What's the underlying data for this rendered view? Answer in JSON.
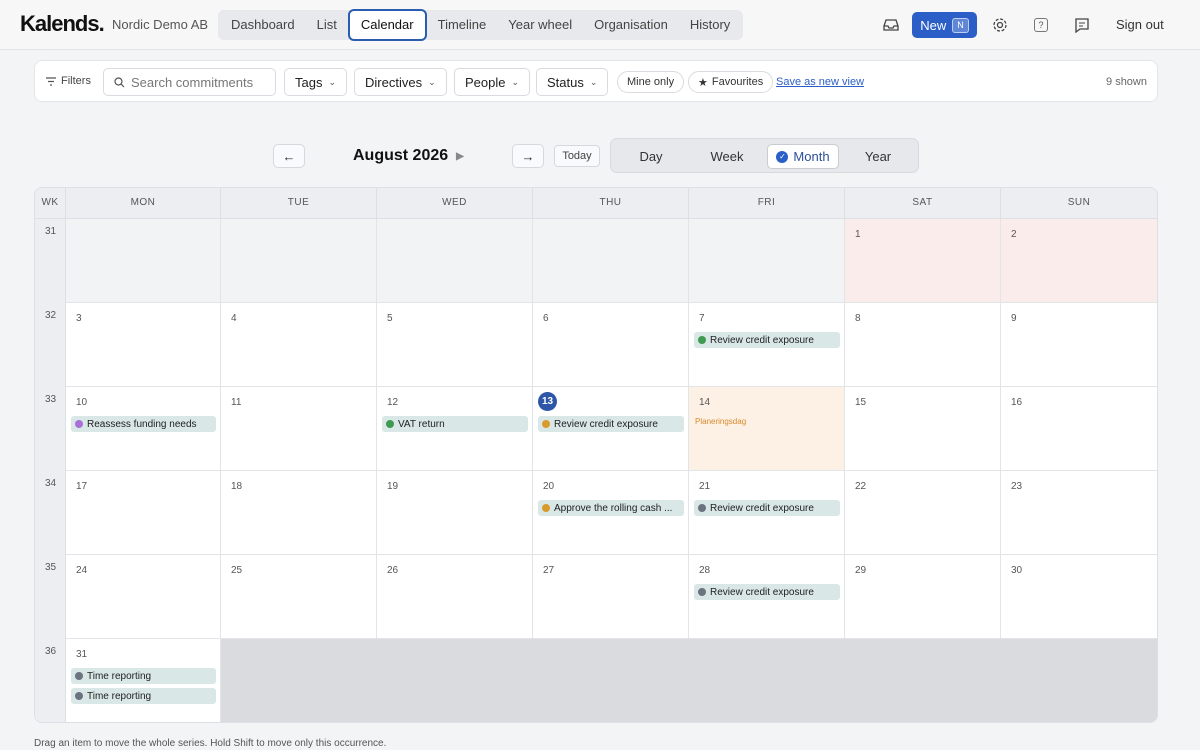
{
  "app": {
    "logo": "Kalends.",
    "org": "Nordic Demo AB"
  },
  "nav": {
    "tabs": [
      {
        "label": "Dashboard"
      },
      {
        "label": "List"
      },
      {
        "label": "Calendar",
        "active": true
      },
      {
        "label": "Timeline"
      },
      {
        "label": "Year wheel"
      },
      {
        "label": "Organisation"
      },
      {
        "label": "History"
      }
    ],
    "new_label": "New",
    "new_shortcut": "N",
    "help_label": "?",
    "signout": "Sign out"
  },
  "filters": {
    "filters_label": "Filters",
    "search_placeholder": "Search commitments",
    "tags": "Tags",
    "directives": "Directives",
    "people": "People",
    "status": "Status",
    "mine_only": "Mine only",
    "favourites": "Favourites",
    "save_view": "Save as new view",
    "shown": "9 shown"
  },
  "calendar_nav": {
    "prev": "←",
    "next": "→",
    "title": "August 2026",
    "today": "Today",
    "views": [
      "Day",
      "Week",
      "Month",
      "Year"
    ],
    "active_view": "Month"
  },
  "grid": {
    "headers": [
      "WK",
      "MON",
      "TUE",
      "WED",
      "THU",
      "FRI",
      "SAT",
      "SUN"
    ],
    "weeks": [
      {
        "wk": "31",
        "days": [
          {
            "n": "",
            "kind": "other"
          },
          {
            "n": "",
            "kind": "other"
          },
          {
            "n": "",
            "kind": "other"
          },
          {
            "n": "",
            "kind": "other"
          },
          {
            "n": "",
            "kind": "other"
          },
          {
            "n": "1",
            "kind": "weekend"
          },
          {
            "n": "2",
            "kind": "weekend"
          }
        ]
      },
      {
        "wk": "32",
        "days": [
          {
            "n": "3"
          },
          {
            "n": "4"
          },
          {
            "n": "5"
          },
          {
            "n": "6"
          },
          {
            "n": "7",
            "events": [
              {
                "label": "Review credit exposure",
                "color": "#3f9a52"
              }
            ]
          },
          {
            "n": "8"
          },
          {
            "n": "9"
          }
        ]
      },
      {
        "wk": "33",
        "days": [
          {
            "n": "10",
            "events": [
              {
                "label": "Reassess funding needs",
                "color": "#a970d6"
              }
            ]
          },
          {
            "n": "11"
          },
          {
            "n": "12",
            "events": [
              {
                "label": "VAT return",
                "color": "#3f9a52"
              }
            ]
          },
          {
            "n": "13",
            "today": true,
            "events": [
              {
                "label": "Review credit exposure",
                "color": "#d89a2a"
              }
            ]
          },
          {
            "n": "14",
            "kind": "special",
            "label": "Planeringsdag"
          },
          {
            "n": "15"
          },
          {
            "n": "16"
          }
        ]
      },
      {
        "wk": "34",
        "days": [
          {
            "n": "17"
          },
          {
            "n": "18"
          },
          {
            "n": "19"
          },
          {
            "n": "20",
            "events": [
              {
                "label": "Approve the rolling cash ...",
                "color": "#d89a2a"
              }
            ]
          },
          {
            "n": "21",
            "events": [
              {
                "label": "Review credit exposure",
                "color": "#6b7280"
              }
            ]
          },
          {
            "n": "22"
          },
          {
            "n": "23"
          }
        ]
      },
      {
        "wk": "35",
        "days": [
          {
            "n": "24"
          },
          {
            "n": "25"
          },
          {
            "n": "26"
          },
          {
            "n": "27"
          },
          {
            "n": "28",
            "events": [
              {
                "label": "Review credit exposure",
                "color": "#6b7280"
              }
            ]
          },
          {
            "n": "29"
          },
          {
            "n": "30"
          }
        ]
      },
      {
        "wk": "36",
        "days": [
          {
            "n": "31",
            "events": [
              {
                "label": "Time reporting",
                "color": "#6b7280"
              },
              {
                "label": "Time reporting",
                "color": "#6b7280"
              }
            ]
          }
        ]
      }
    ]
  },
  "footnote": "Drag an item to move the whole series. Hold Shift to move only this occurrence.",
  "icons": [
    "inbox-icon",
    "gear-icon",
    "help-icon",
    "feedback-icon",
    "filter-icon",
    "search-icon",
    "star-icon",
    "check-icon"
  ]
}
